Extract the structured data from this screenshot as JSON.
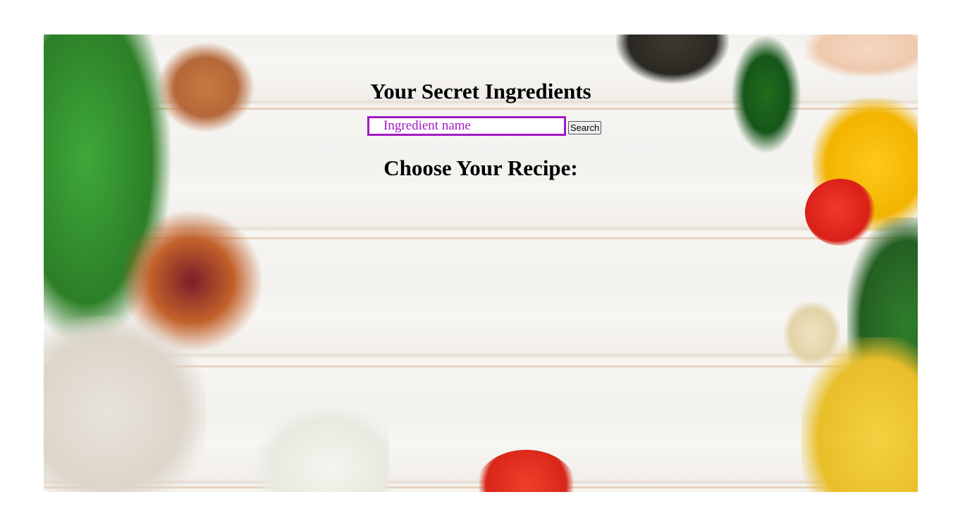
{
  "page": {
    "title": "Your Secret Ingredients",
    "subtitle": "Choose Your Recipe:"
  },
  "search": {
    "placeholder": "Ingredient name",
    "button_label": "Search"
  },
  "colors": {
    "accent": "#a21bc3",
    "background": "#ffffff"
  },
  "background_image": "food-ingredients-wooden-table"
}
